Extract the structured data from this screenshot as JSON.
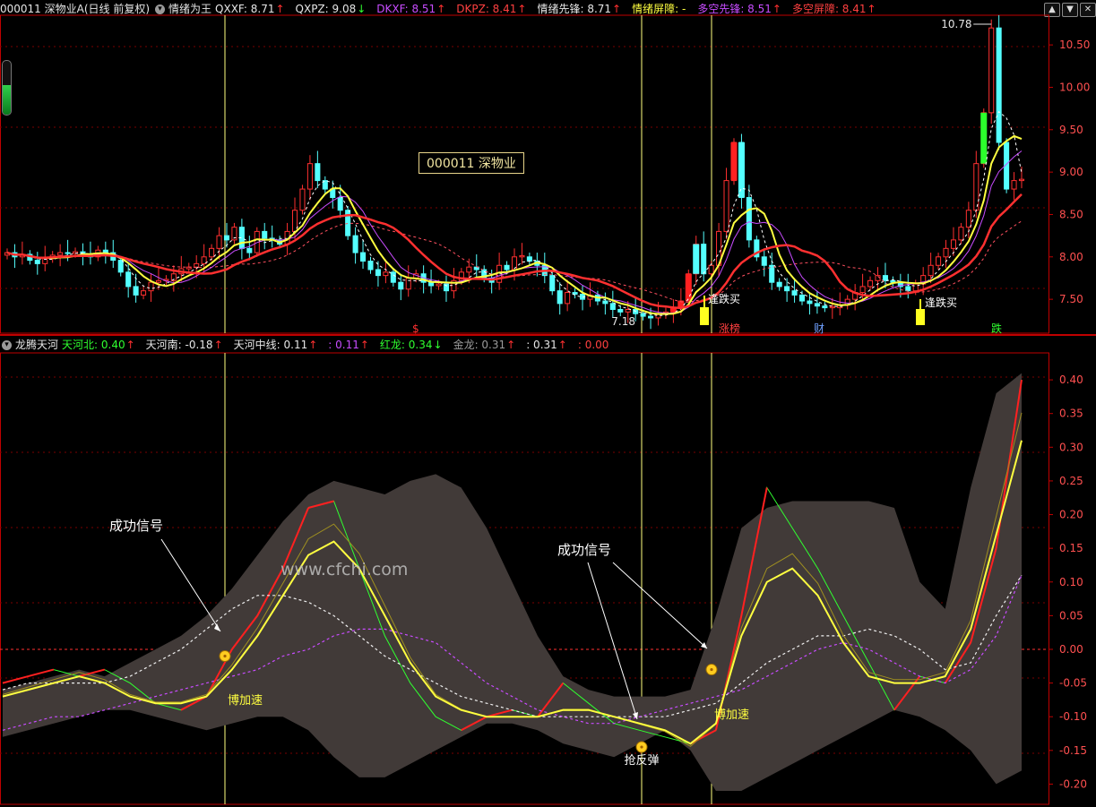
{
  "top_legend": {
    "stock": "000011 深物业A(日线 前复权)",
    "indicator": "情绪为王",
    "items": [
      {
        "label": "QXXF: 8.71",
        "arrow": "↑",
        "color": "#e6e6e6"
      },
      {
        "label": "QXPZ: 9.08",
        "arrow": "↓",
        "color": "#e6e6e6"
      },
      {
        "label": "DKXF: 8.51",
        "arrow": "↑",
        "color": "#c84cff"
      },
      {
        "label": "DKPZ: 8.41",
        "arrow": "↑",
        "color": "#ff4040"
      },
      {
        "label": "情绪先锋: 8.71",
        "arrow": "↑",
        "color": "#e6e6e6"
      },
      {
        "label": "情绪屏障: -",
        "arrow": "",
        "color": "#ffff40"
      },
      {
        "label": "多空先锋: 8.51",
        "arrow": "↑",
        "color": "#c84cff"
      },
      {
        "label": "多空屏障: 8.41",
        "arrow": "↑",
        "color": "#ff4040"
      }
    ]
  },
  "bottom_legend": {
    "indicator": "龙腾天河",
    "items": [
      {
        "label": "天河北: 0.40",
        "arrow": "↑",
        "color": "#30ff30"
      },
      {
        "label": "天河南: -0.18",
        "arrow": "↑",
        "color": "#e6e6e6"
      },
      {
        "label": "天河中线: 0.11",
        "arrow": "↑",
        "color": "#e6e6e6"
      },
      {
        "label": ": 0.11",
        "arrow": "↑",
        "color": "#c84cff"
      },
      {
        "label": "红龙: 0.34",
        "arrow": "↓",
        "color": "#30ff30"
      },
      {
        "label": "金龙: 0.31",
        "arrow": "↑",
        "color": "#9a9a9a"
      },
      {
        "label": ": 0.31",
        "arrow": "↑",
        "color": "#e6e6e6"
      },
      {
        "label": ": 0.00",
        "arrow": "",
        "color": "#ff4040"
      }
    ]
  },
  "window_buttons": [
    "▲",
    "▼",
    "✕"
  ],
  "stock_tag": "000011 深物业",
  "watermark": "www.cfchi.com",
  "colors": {
    "up": "#ff3030",
    "down": "#54ffff",
    "grid": "#7a0000",
    "axis": "#c00000",
    "band": "#413a38"
  },
  "chart_data": [
    {
      "type": "candlestick",
      "ylim": [
        7.1,
        10.85
      ],
      "y_ticks": [
        "7.50",
        "8.00",
        "8.50",
        "9.00",
        "9.50",
        "10.00",
        "10.50"
      ],
      "y_tick_values": [
        7.5,
        8.0,
        8.5,
        9.0,
        9.5,
        10.0,
        10.5
      ],
      "high_label": "10.78",
      "low_label": "7.18",
      "annotations": [
        "逢跌买",
        "逢跌买"
      ],
      "bottom_marks": [
        {
          "text": "$",
          "color": "#ff3030"
        },
        {
          "text": "涨榜",
          "color": "#ff4040"
        },
        {
          "text": "财",
          "color": "#6fa0ff"
        },
        {
          "text": "跌",
          "color": "#30ff30"
        }
      ],
      "closes": [
        8.05,
        8.0,
        8.03,
        7.96,
        7.92,
        7.98,
        8.02,
        8.05,
        8.04,
        8.06,
        8.03,
        8.0,
        8.08,
        8.05,
        7.96,
        7.82,
        7.65,
        7.55,
        7.6,
        7.7,
        7.72,
        7.72,
        7.8,
        7.86,
        7.88,
        7.92,
        8.0,
        8.1,
        8.25,
        8.2,
        8.35,
        8.1,
        8.05,
        8.3,
        8.22,
        8.2,
        8.15,
        8.3,
        8.55,
        8.8,
        9.1,
        8.9,
        8.8,
        8.7,
        8.55,
        8.25,
        8.05,
        7.95,
        7.85,
        7.78,
        7.82,
        7.7,
        7.62,
        7.75,
        7.8,
        7.7,
        7.66,
        7.68,
        7.6,
        7.72,
        7.82,
        7.88,
        7.85,
        7.75,
        7.7,
        7.9,
        7.85,
        8.0,
        8.0,
        7.95,
        7.9,
        7.78,
        7.6,
        7.45,
        7.58,
        7.56,
        7.5,
        7.55,
        7.48,
        7.45,
        7.38,
        7.35,
        7.38,
        7.33,
        7.3,
        7.28,
        7.32,
        7.35,
        7.4,
        7.48,
        7.8,
        8.15,
        7.8,
        7.9,
        8.3,
        8.9,
        9.35,
        8.7,
        8.2,
        8.0,
        7.9,
        7.7,
        7.65,
        7.6,
        7.55,
        7.48,
        7.45,
        7.42,
        7.4,
        7.4,
        7.43,
        7.5,
        7.58,
        7.65,
        7.72,
        7.78,
        7.72,
        7.7,
        7.65,
        7.6,
        7.68,
        7.78,
        7.9,
        8.0,
        8.1,
        8.2,
        8.35,
        8.55,
        9.1,
        9.7,
        10.7,
        9.35,
        8.8,
        8.9,
        8.9
      ],
      "series": [
        {
          "name": "情绪先锋",
          "color": "#ffff40"
        },
        {
          "name": "多空先锋",
          "color": "#c84cff"
        },
        {
          "name": "多空屏障",
          "color": "#ff3030"
        }
      ]
    },
    {
      "type": "line",
      "ylim": [
        -0.23,
        0.44
      ],
      "y_ticks": [
        "0.40",
        "0.35",
        "0.30",
        "0.25",
        "0.20",
        "0.15",
        "0.10",
        "0.05",
        "0.00",
        "-0.05",
        "-0.10",
        "-0.15",
        "-0.20"
      ],
      "y_tick_values": [
        0.4,
        0.35,
        0.3,
        0.25,
        0.2,
        0.15,
        0.1,
        0.05,
        0.0,
        -0.05,
        -0.1,
        -0.15,
        -0.2
      ],
      "annotations": [
        "成功信号",
        "成功信号"
      ],
      "signal_labels": [
        "博加速",
        "抢反弹",
        "博加速"
      ],
      "band_upper": [
        -0.06,
        -0.05,
        -0.04,
        -0.03,
        -0.04,
        -0.02,
        0.0,
        0.02,
        0.05,
        0.09,
        0.14,
        0.19,
        0.23,
        0.25,
        0.24,
        0.23,
        0.25,
        0.26,
        0.24,
        0.18,
        0.1,
        0.02,
        -0.04,
        -0.06,
        -0.07,
        -0.07,
        -0.07,
        -0.06,
        0.05,
        0.18,
        0.21,
        0.22,
        0.22,
        0.22,
        0.22,
        0.21,
        0.1,
        0.06,
        0.24,
        0.38,
        0.41
      ],
      "band_lower": [
        -0.13,
        -0.12,
        -0.11,
        -0.1,
        -0.09,
        -0.09,
        -0.1,
        -0.11,
        -0.12,
        -0.11,
        -0.1,
        -0.1,
        -0.12,
        -0.16,
        -0.19,
        -0.19,
        -0.17,
        -0.15,
        -0.13,
        -0.11,
        -0.11,
        -0.12,
        -0.14,
        -0.15,
        -0.16,
        -0.14,
        -0.12,
        -0.15,
        -0.21,
        -0.21,
        -0.19,
        -0.17,
        -0.15,
        -0.13,
        -0.11,
        -0.09,
        -0.1,
        -0.12,
        -0.15,
        -0.2,
        -0.18
      ],
      "series": [
        {
          "name": "红龙",
          "color": "#ff2020",
          "values": [
            -0.05,
            -0.04,
            -0.03,
            -0.04,
            -0.03,
            -0.05,
            -0.08,
            -0.09,
            -0.07,
            0.0,
            0.05,
            0.12,
            0.21,
            0.22,
            0.12,
            0.02,
            -0.05,
            -0.1,
            -0.12,
            -0.1,
            -0.09,
            -0.1,
            -0.05,
            -0.08,
            -0.11,
            -0.12,
            -0.13,
            -0.14,
            -0.12,
            0.05,
            0.24,
            0.18,
            0.12,
            0.05,
            -0.02,
            -0.09,
            -0.04,
            -0.05,
            0.01,
            0.15,
            0.4
          ]
        },
        {
          "name": "天河北",
          "color": "#30ff30",
          "values": [
            -0.05,
            -0.04,
            -0.03,
            -0.04,
            -0.03,
            -0.05,
            -0.08,
            -0.09,
            -0.07,
            0.0,
            0.05,
            0.12,
            0.21,
            0.22,
            0.12,
            0.02,
            -0.05,
            -0.1,
            -0.12,
            -0.1,
            -0.09,
            -0.1,
            -0.05,
            -0.08,
            -0.11,
            -0.12,
            -0.13,
            -0.14,
            -0.12,
            0.05,
            0.24,
            0.18,
            0.12,
            0.05,
            -0.02,
            -0.09,
            -0.04,
            -0.05,
            0.01,
            0.15,
            0.4
          ]
        },
        {
          "name": "金龙",
          "color": "#ffff40",
          "values": [
            -0.07,
            -0.06,
            -0.05,
            -0.04,
            -0.05,
            -0.07,
            -0.08,
            -0.08,
            -0.07,
            -0.03,
            0.02,
            0.08,
            0.14,
            0.16,
            0.12,
            0.05,
            -0.02,
            -0.07,
            -0.09,
            -0.1,
            -0.1,
            -0.1,
            -0.09,
            -0.09,
            -0.1,
            -0.11,
            -0.12,
            -0.14,
            -0.11,
            0.02,
            0.1,
            0.12,
            0.08,
            0.01,
            -0.04,
            -0.05,
            -0.05,
            -0.04,
            0.03,
            0.17,
            0.31
          ]
        },
        {
          "name": "天河中线",
          "color": "#f0f0f0",
          "values": [
            -0.06,
            -0.05,
            -0.05,
            -0.05,
            -0.05,
            -0.04,
            -0.02,
            0.0,
            0.03,
            0.06,
            0.08,
            0.08,
            0.07,
            0.05,
            0.02,
            -0.01,
            -0.03,
            -0.05,
            -0.07,
            -0.08,
            -0.09,
            -0.1,
            -0.1,
            -0.1,
            -0.1,
            -0.1,
            -0.1,
            -0.09,
            -0.08,
            -0.05,
            -0.02,
            0.0,
            0.02,
            0.02,
            0.03,
            0.02,
            0.0,
            -0.03,
            -0.02,
            0.05,
            0.11
          ]
        },
        {
          "name": "天河南",
          "color": "#c84cff",
          "values": [
            -0.12,
            -0.11,
            -0.1,
            -0.1,
            -0.09,
            -0.08,
            -0.07,
            -0.06,
            -0.05,
            -0.04,
            -0.03,
            -0.01,
            0.0,
            0.02,
            0.03,
            0.03,
            0.02,
            0.01,
            -0.02,
            -0.05,
            -0.07,
            -0.09,
            -0.1,
            -0.11,
            -0.11,
            -0.1,
            -0.09,
            -0.08,
            -0.07,
            -0.06,
            -0.04,
            -0.02,
            0.0,
            0.01,
            0.0,
            -0.02,
            -0.04,
            -0.05,
            -0.03,
            0.02,
            0.11
          ]
        }
      ]
    }
  ]
}
